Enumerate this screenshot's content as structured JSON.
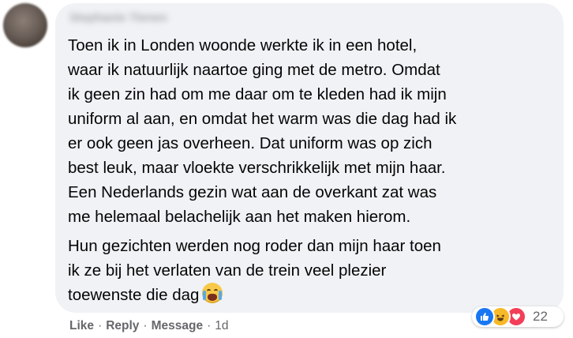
{
  "comment": {
    "author_name": "Stephanie Tienen",
    "paragraphs": [
      {
        "lines": [
          "Toen ik in Londen woonde werkte ik in een hotel,",
          "waar ik natuurlijk naartoe ging met de metro. Omdat",
          "ik geen zin had om me daar om te kleden had ik mijn",
          "uniform al aan, en omdat het warm was die dag had ik",
          "er ook geen jas overheen. Dat uniform was op zich",
          "best leuk, maar vloekte verschrikkelijk met mijn haar.",
          "Een Nederlands gezin wat aan de overkant zat was",
          "me helemaal belachelijk aan het maken hierom."
        ]
      },
      {
        "lines": [
          "Hun gezichten werden nog roder dan mijn haar toen",
          "ik ze bij het verlaten van de trein veel plezier",
          "toewenste die dag"
        ],
        "trailing_emoji": "crying-face-icon"
      }
    ]
  },
  "actions": {
    "like": "Like",
    "reply": "Reply",
    "message": "Message",
    "separator": "·",
    "timestamp": "1d"
  },
  "reactions": {
    "icons": [
      "like-icon",
      "haha-icon",
      "love-icon"
    ],
    "count": "22",
    "colors": {
      "like": "#1877f2",
      "haha": "#f7b928",
      "love": "#f33e58"
    }
  },
  "colors": {
    "bubble_bg": "#f0f2f5",
    "text": "#050505",
    "secondary_text": "#65676b"
  }
}
